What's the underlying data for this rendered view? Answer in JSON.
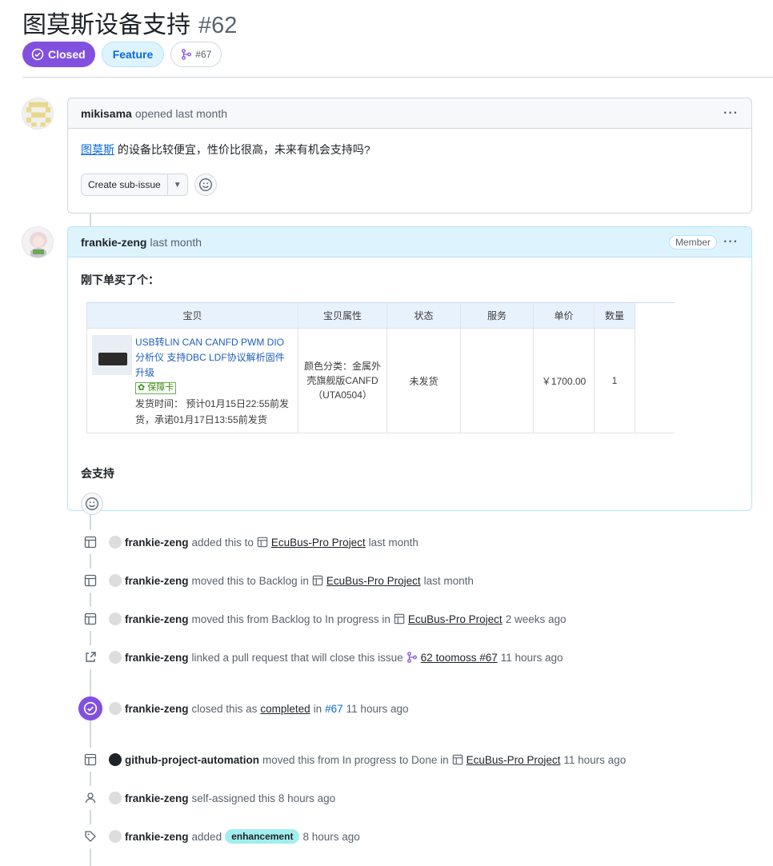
{
  "issue": {
    "title": "图莫斯设备支持",
    "number": "#62",
    "state": "Closed",
    "label_feature": "Feature",
    "linked_pr": "#67"
  },
  "comment1": {
    "author": "mikisama",
    "when": "opened last month",
    "link_text": "图莫斯",
    "text": " 的设备比较便宜，性价比很高，未来有机会支持吗?",
    "sub_issue_btn": "Create sub-issue"
  },
  "comment2": {
    "author": "frankie-zeng",
    "when": "last month",
    "badge": "Member",
    "intro": "刚下单买了个：",
    "table": {
      "headers": [
        "宝贝",
        "宝贝属性",
        "状态",
        "服务",
        "单价",
        "数量"
      ],
      "product_title": "USB转LIN CAN CANFD PWM DIO分析仪 支持DBC LDF协议解析固件升级",
      "guarantee": "保障卡",
      "ship_time": "发货时间： 预计01月15日22:55前发货，承诺01月17日13:55前发货",
      "attribute": "颜色分类：金属外壳旗舰版CANFD（UTA0504）",
      "status": "未发货",
      "service": "",
      "price": "￥1700.00",
      "qty": "1"
    },
    "closing": "会支持"
  },
  "timeline": {
    "project": "EcuBus-Pro Project",
    "e1": {
      "who": "frankie-zeng",
      "pre": "added this to",
      "post": "last month"
    },
    "e2": {
      "who": "frankie-zeng",
      "pre": "moved this to Backlog in",
      "post": "last month"
    },
    "e3": {
      "who": "frankie-zeng",
      "pre": "moved this from Backlog to In progress in",
      "post": "2 weeks ago"
    },
    "e4": {
      "who": "frankie-zeng",
      "pre": "linked a pull request that will close this issue",
      "pr": "62 toomoss #67",
      "post": "11 hours ago"
    },
    "e5": {
      "who": "frankie-zeng",
      "pre": "closed this as",
      "completed": "completed",
      "in": "in",
      "pr": "#67",
      "post": "11 hours ago"
    },
    "e6": {
      "who": "github-project-automation",
      "pre": "moved this from In progress to Done in",
      "post": "11 hours ago"
    },
    "e7": {
      "who": "frankie-zeng",
      "pre": "self-assigned this",
      "post": "8 hours ago"
    },
    "e8": {
      "who": "frankie-zeng",
      "pre": "added",
      "label": "enhancement",
      "post": "8 hours ago"
    }
  }
}
